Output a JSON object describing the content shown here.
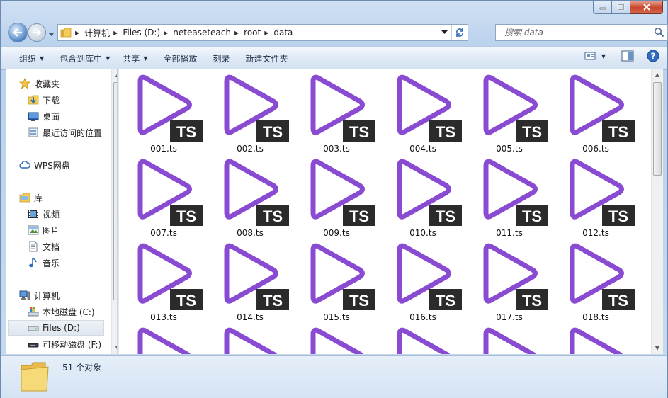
{
  "address": {
    "crumbs": [
      "计算机",
      "Files (D:)",
      "neteaseteach",
      "root",
      "data"
    ]
  },
  "search": {
    "placeholder": "搜索 data"
  },
  "toolbar": {
    "organize": "组织",
    "include_in_library": "包含到库中",
    "share": "共享",
    "play_all": "全部播放",
    "burn": "刻录",
    "new_folder": "新建文件夹"
  },
  "sidebar": {
    "favorites": "收藏夹",
    "downloads": "下载",
    "desktop": "桌面",
    "recent": "最近访问的位置",
    "wps": "WPS网盘",
    "libraries": "库",
    "videos": "视频",
    "pictures": "图片",
    "documents": "文档",
    "music": "音乐",
    "computer": "计算机",
    "local_c": "本地磁盘 (C:)",
    "files_d": "Files (D:)",
    "removable_f": "可移动磁盘 (F:)"
  },
  "files": {
    "badge": "TS",
    "items": [
      "001.ts",
      "002.ts",
      "003.ts",
      "004.ts",
      "005.ts",
      "006.ts",
      "007.ts",
      "008.ts",
      "009.ts",
      "010.ts",
      "011.ts",
      "012.ts",
      "013.ts",
      "014.ts",
      "015.ts",
      "016.ts",
      "017.ts",
      "018.ts"
    ]
  },
  "status": {
    "count_text": "51 个对象"
  },
  "colors": {
    "play_icon": "#8a4bd3",
    "badge_bg": "#2b2b2b",
    "accent": "#3b6db3"
  }
}
